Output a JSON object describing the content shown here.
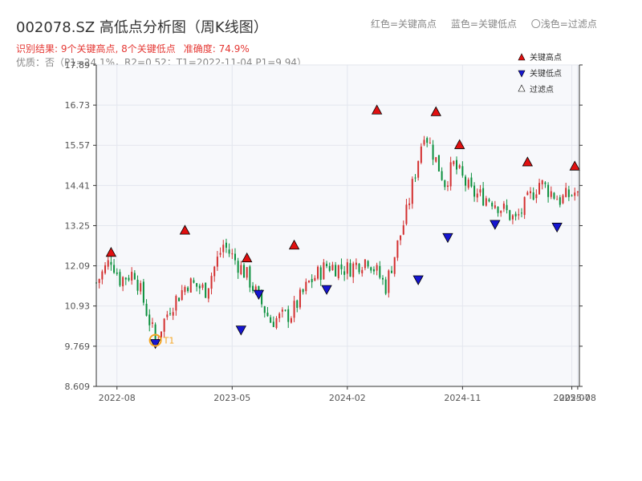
{
  "header": {
    "title": "002078.SZ 高低点分析图（周K线图）",
    "legend_red": "红色=关键高点",
    "legend_blue": "蓝色=关键低点",
    "legend_light": "〇浅色=过滤点",
    "result_text": "识别结果: 9个关键高点, 8个关键低点",
    "accuracy_text": "准确度: 74.9%",
    "quality_text": "优质：否（P1=24.1%，R2=0.52；T1=2022-11-04 P1=9.94）"
  },
  "colors": {
    "up": "#d32f2f",
    "down": "#0a8f3c",
    "high_marker": "#e01010",
    "low_marker": "#1515d0",
    "t1_marker": "#f5a623",
    "plot_bg": "#f7f8fb",
    "grid": "#e3e6ee"
  },
  "chart_data": {
    "type": "candlestick",
    "x_range": [
      "2022-06-17",
      "2025-08-05"
    ],
    "ylim": [
      8.609,
      17.89
    ],
    "yticks": [
      8.609,
      9.769,
      10.93,
      12.09,
      13.25,
      14.41,
      15.57,
      16.73,
      17.89
    ],
    "ytick_labels": [
      "8.609",
      "9.769",
      "10.93",
      "12.09",
      "13.25",
      "14.41",
      "15.57",
      "16.73",
      "17.89"
    ],
    "xticks": [
      {
        "date": "2022-08-05",
        "label": "2022-08"
      },
      {
        "date": "2023-05-05",
        "label": "2023-05"
      },
      {
        "date": "2024-02-02",
        "label": "2024-02"
      },
      {
        "date": "2024-11-01",
        "label": "2024-11"
      },
      {
        "date": "2025-07-18",
        "label": "2025-07"
      },
      {
        "date": "2025-08-01",
        "label": "2025-08"
      }
    ],
    "legend": [
      "关键高点",
      "关键低点",
      "过滤点"
    ],
    "legend_placement": "top-right",
    "grid": true,
    "price_path": [
      [
        "2022-06-17",
        11.6
      ],
      [
        "2022-07-22",
        12.3
      ],
      [
        "2022-08-12",
        11.7
      ],
      [
        "2022-09-16",
        11.9
      ],
      [
        "2022-11-04",
        9.94
      ],
      [
        "2022-12-09",
        10.9
      ],
      [
        "2023-01-20",
        11.6
      ],
      [
        "2023-03-03",
        11.4
      ],
      [
        "2023-04-14",
        12.7
      ],
      [
        "2023-06-09",
        11.8
      ],
      [
        "2023-08-04",
        10.5
      ],
      [
        "2023-09-22",
        10.7
      ],
      [
        "2023-11-03",
        11.6
      ],
      [
        "2023-12-15",
        12.1
      ],
      [
        "2024-02-02",
        12.0
      ],
      [
        "2024-03-22",
        12.3
      ],
      [
        "2024-05-03",
        11.5
      ],
      [
        "2024-06-21",
        13.6
      ],
      [
        "2024-08-02",
        16.0
      ],
      [
        "2024-09-20",
        14.5
      ],
      [
        "2024-10-11",
        15.0
      ],
      [
        "2024-11-22",
        14.2
      ],
      [
        "2025-01-10",
        14.0
      ],
      [
        "2025-03-07",
        13.4
      ],
      [
        "2025-05-02",
        14.5
      ],
      [
        "2025-06-20",
        14.0
      ],
      [
        "2025-07-25",
        14.2
      ],
      [
        "2025-08-05",
        14.0
      ]
    ],
    "key_highs": [
      {
        "date": "2022-07-22",
        "value": 12.34
      },
      {
        "date": "2023-01-13",
        "value": 12.98
      },
      {
        "date": "2023-06-09",
        "value": 12.18
      },
      {
        "date": "2023-09-29",
        "value": 12.55
      },
      {
        "date": "2024-04-12",
        "value": 16.45
      },
      {
        "date": "2024-08-30",
        "value": 16.4
      },
      {
        "date": "2024-10-25",
        "value": 15.45
      },
      {
        "date": "2025-04-04",
        "value": 14.95
      },
      {
        "date": "2025-07-25",
        "value": 14.83
      }
    ],
    "key_lows": [
      {
        "date": "2022-11-04",
        "value": 9.94
      },
      {
        "date": "2023-05-26",
        "value": 10.33
      },
      {
        "date": "2023-07-07",
        "value": 11.36
      },
      {
        "date": "2023-12-15",
        "value": 11.5
      },
      {
        "date": "2024-07-19",
        "value": 11.78
      },
      {
        "date": "2024-09-27",
        "value": 13.0
      },
      {
        "date": "2025-01-17",
        "value": 13.38
      },
      {
        "date": "2025-06-13",
        "value": 13.3
      }
    ],
    "t1_point": {
      "date": "2022-11-04",
      "value": 9.94,
      "label": "T1"
    }
  }
}
